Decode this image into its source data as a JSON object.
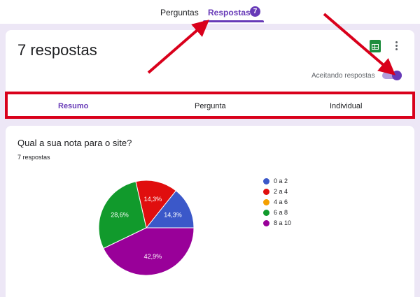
{
  "nav": {
    "tab_questions": "Perguntas",
    "tab_responses": "Respostas",
    "responses_badge": "7"
  },
  "header": {
    "title": "7 respostas",
    "accepting_label": "Aceitando respostas",
    "accepting": true
  },
  "subtabs": {
    "summary": "Resumo",
    "question": "Pergunta",
    "individual": "Individual"
  },
  "question": {
    "title": "Qual a sua nota para o site?",
    "count": "7 respostas"
  },
  "colors": {
    "accent": "#673ab7",
    "highlight": "#d9001b"
  },
  "icons": {
    "sheets": "google-sheets-icon",
    "more": "more-vert-icon"
  },
  "chart_data": {
    "type": "pie",
    "categories": [
      "0 a 2",
      "2 a 4",
      "4 a 6",
      "6 a 8",
      "8 a 10"
    ],
    "values": [
      14.3,
      14.3,
      0,
      28.6,
      42.9
    ],
    "labels": [
      "14,3%",
      "14,3%",
      "",
      "28,6%",
      "42,9%"
    ],
    "colors": [
      "#3b58c9",
      "#e00e0e",
      "#f4a000",
      "#119a2c",
      "#990099"
    ],
    "legend_position": "right"
  }
}
